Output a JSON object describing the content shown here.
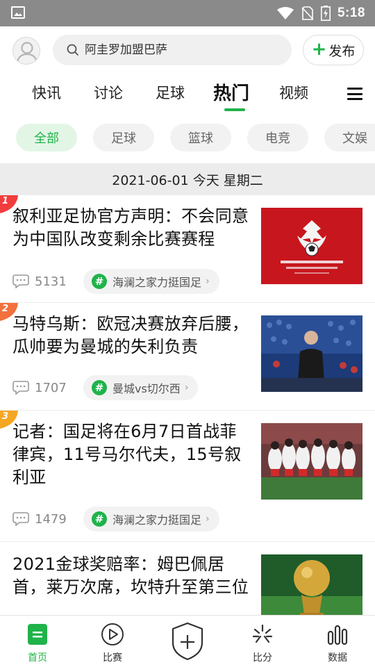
{
  "status_bar": {
    "time": "5:18"
  },
  "header": {
    "search_placeholder": "阿圭罗加盟巴萨",
    "publish_label": "发布"
  },
  "tabs": [
    {
      "label": "快讯"
    },
    {
      "label": "讨论"
    },
    {
      "label": "足球"
    },
    {
      "label": "热门",
      "active": true
    },
    {
      "label": "视频"
    }
  ],
  "chips": [
    {
      "label": "全部",
      "active": true
    },
    {
      "label": "足球"
    },
    {
      "label": "篮球"
    },
    {
      "label": "电竞"
    },
    {
      "label": "文娱"
    }
  ],
  "date_bar": {
    "text": "2021-06-01 今天 星期二"
  },
  "news": [
    {
      "rank": "1",
      "rank_color": "#f23d3d",
      "title": "叙利亚足协官方声明：不会同意为中国队改变剩余比赛赛程",
      "comments": "5131",
      "topic": "海澜之家力挺国足"
    },
    {
      "rank": "2",
      "rank_color": "#f2713d",
      "title": "马特乌斯：欧冠决赛放弃后腰，瓜帅要为曼城的失利负责",
      "comments": "1707",
      "topic": "曼城vs切尔西"
    },
    {
      "rank": "3",
      "rank_color": "#f5a623",
      "title": "记者：国足将在6月7日首战菲律宾，11号马尔代夫，15号叙利亚",
      "comments": "1479",
      "topic": "海澜之家力挺国足"
    },
    {
      "rank": "",
      "title": "2021金球奖赔率：姆巴佩居首，莱万次席，坎特升至第三位"
    }
  ],
  "bottom_nav": [
    {
      "label": "首页",
      "icon": "home-icon",
      "active": true
    },
    {
      "label": "比赛",
      "icon": "play-icon"
    },
    {
      "label": "",
      "icon": "shield-plus-icon"
    },
    {
      "label": "比分",
      "icon": "score-icon"
    },
    {
      "label": "数据",
      "icon": "data-bars-icon"
    }
  ],
  "colors": {
    "accent": "#1fb34a",
    "status_bar": "#8a8a8a"
  }
}
